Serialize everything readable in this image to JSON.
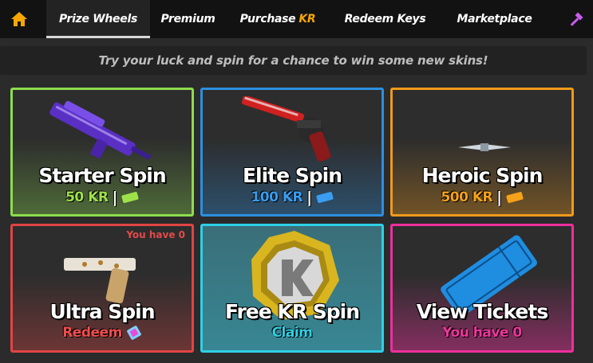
{
  "nav": {
    "tabs": [
      {
        "label": "Prize Wheels"
      },
      {
        "label": "Premium"
      },
      {
        "label": "Purchase",
        "accent": "KR"
      },
      {
        "label": "Redeem Keys"
      },
      {
        "label": "Marketplace"
      }
    ]
  },
  "tagline": "Try your luck and spin for a chance to win some new skins!",
  "cards": [
    {
      "title": "Starter Spin",
      "price": "50 KR",
      "sep": "|",
      "border": "#8ddc4e",
      "price_color": "#9ee24a"
    },
    {
      "title": "Elite Spin",
      "price": "100 KR",
      "sep": "|",
      "border": "#2d8fe0",
      "price_color": "#3a9df0"
    },
    {
      "title": "Heroic Spin",
      "price": "500 KR",
      "sep": "|",
      "border": "#f09a1a",
      "price_color": "#f5a21a"
    },
    {
      "title": "Ultra Spin",
      "note": "You have 0",
      "sub": "Redeem",
      "border": "#e24444",
      "sub_color": "#ef4d4d"
    },
    {
      "title": "Free KR Spin",
      "sub": "Claim",
      "border": "#2fd0e6",
      "sub_color": "#2fd0e6"
    },
    {
      "title": "View Tickets",
      "sub": "You have 0",
      "border": "#ee2f9c",
      "sub_color": "#f0359f"
    }
  ]
}
